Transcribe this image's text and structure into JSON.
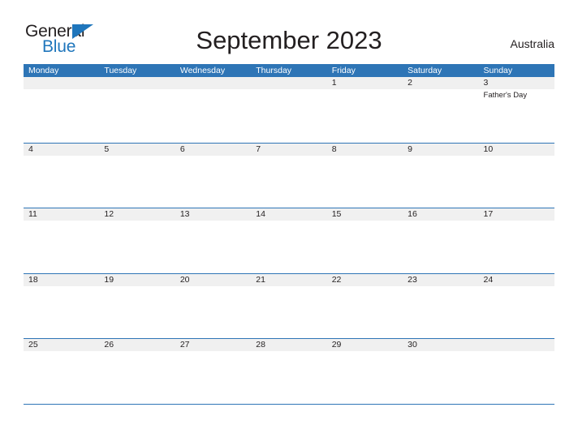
{
  "brand": {
    "name_primary": "General",
    "name_secondary": "Blue",
    "triangle_color": "#1f76bc",
    "primary_color": "#231f20"
  },
  "header": {
    "title": "September 2023",
    "region": "Australia"
  },
  "theme": {
    "header_blue": "#2e75b6",
    "band_gray": "#f0f0f0",
    "text_color": "#231f20",
    "background": "#ffffff"
  },
  "calendar": {
    "month": "September",
    "year": "2023",
    "weekday_headers": [
      "Monday",
      "Tuesday",
      "Wednesday",
      "Thursday",
      "Friday",
      "Saturday",
      "Sunday"
    ],
    "weeks": [
      [
        {
          "date": "",
          "events": []
        },
        {
          "date": "",
          "events": []
        },
        {
          "date": "",
          "events": []
        },
        {
          "date": "",
          "events": []
        },
        {
          "date": "1",
          "events": []
        },
        {
          "date": "2",
          "events": []
        },
        {
          "date": "3",
          "events": [
            "Father's Day"
          ]
        }
      ],
      [
        {
          "date": "4",
          "events": []
        },
        {
          "date": "5",
          "events": []
        },
        {
          "date": "6",
          "events": []
        },
        {
          "date": "7",
          "events": []
        },
        {
          "date": "8",
          "events": []
        },
        {
          "date": "9",
          "events": []
        },
        {
          "date": "10",
          "events": []
        }
      ],
      [
        {
          "date": "11",
          "events": []
        },
        {
          "date": "12",
          "events": []
        },
        {
          "date": "13",
          "events": []
        },
        {
          "date": "14",
          "events": []
        },
        {
          "date": "15",
          "events": []
        },
        {
          "date": "16",
          "events": []
        },
        {
          "date": "17",
          "events": []
        }
      ],
      [
        {
          "date": "18",
          "events": []
        },
        {
          "date": "19",
          "events": []
        },
        {
          "date": "20",
          "events": []
        },
        {
          "date": "21",
          "events": []
        },
        {
          "date": "22",
          "events": []
        },
        {
          "date": "23",
          "events": []
        },
        {
          "date": "24",
          "events": []
        }
      ],
      [
        {
          "date": "25",
          "events": []
        },
        {
          "date": "26",
          "events": []
        },
        {
          "date": "27",
          "events": []
        },
        {
          "date": "28",
          "events": []
        },
        {
          "date": "29",
          "events": []
        },
        {
          "date": "30",
          "events": []
        },
        {
          "date": "",
          "events": []
        }
      ]
    ]
  }
}
